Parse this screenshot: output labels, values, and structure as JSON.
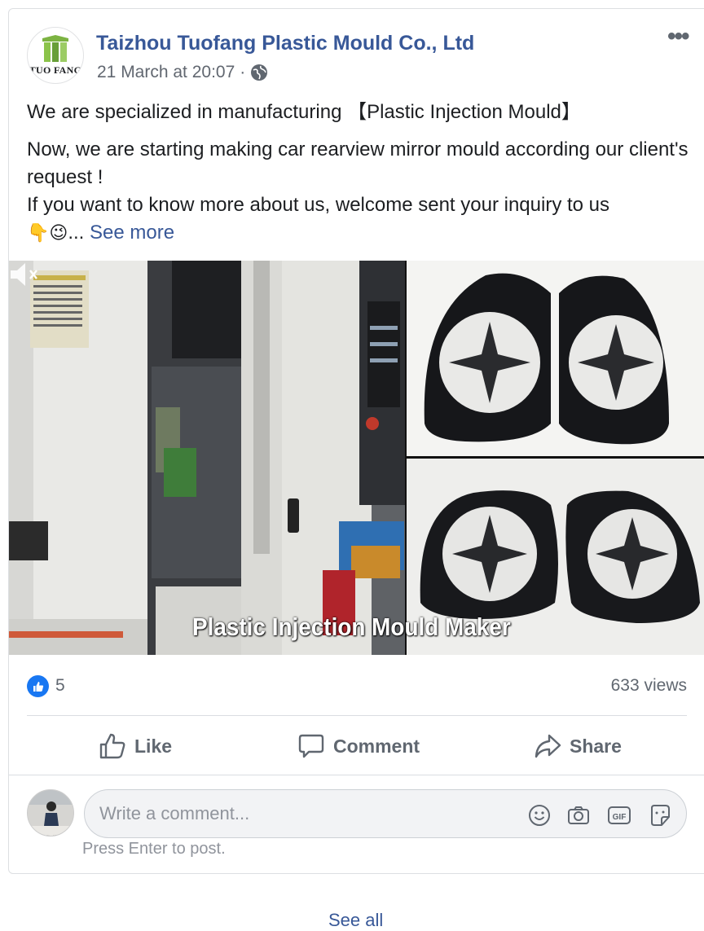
{
  "post": {
    "page_name": "Taizhou Tuofang Plastic Mould Co., Ltd",
    "logo_text": "TUO FANG",
    "timestamp": "21 March at 20:07",
    "separator": "·",
    "privacy_icon": "globe-icon",
    "more_icon": "more-options-icon",
    "text": {
      "line1": "We are specialized in manufacturing 【Plastic Injection Mould】",
      "line2": "Now, we are starting making car rearview mirror mould according our client's request !",
      "line3": "If you want to know more about us, welcome sent your inquiry to us",
      "emoji1": "👇",
      "emoji2": "😉",
      "ellipsis": "...",
      "see_more": "See more"
    },
    "video": {
      "overlay_text": "Plastic Injection Mould Maker",
      "mute_icon": "speaker-muted-icon"
    }
  },
  "stats": {
    "like_count": "5",
    "views": "633 views"
  },
  "actions": {
    "like_label": "Like",
    "comment_label": "Comment",
    "share_label": "Share"
  },
  "comment": {
    "placeholder": "Write a comment...",
    "hint": "Press Enter to post.",
    "icons": [
      "emoji-icon",
      "camera-icon",
      "gif-icon",
      "sticker-icon"
    ]
  },
  "footer": {
    "see_all": "See all"
  },
  "colors": {
    "link": "#385898",
    "like_blue": "#1877f2",
    "muted_text": "#606770"
  }
}
